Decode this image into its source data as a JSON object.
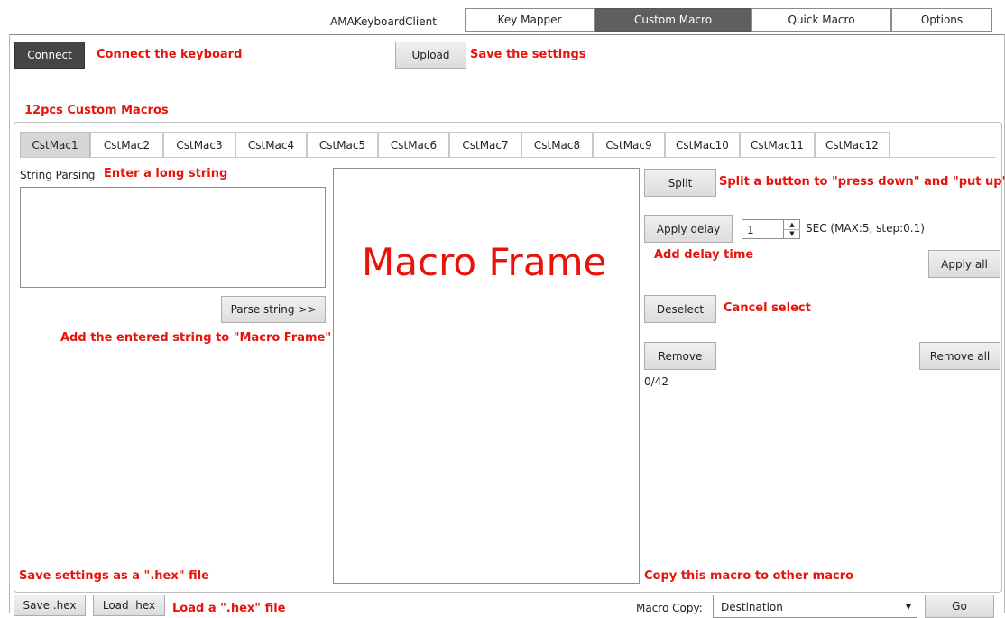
{
  "app": {
    "title": "AMAKeyboardClient",
    "tabs": [
      {
        "label": "Key Mapper"
      },
      {
        "label": "Custom Macro"
      },
      {
        "label": "Quick Macro"
      },
      {
        "label": "Options"
      }
    ],
    "active_tab": "Custom Macro"
  },
  "toolbar": {
    "connect_label": "Connect",
    "connect_note": "Connect the keyboard",
    "upload_label": "Upload",
    "upload_note": "Save the settings"
  },
  "macros": {
    "section_note": "12pcs Custom Macros",
    "tabs": [
      "CstMac1",
      "CstMac2",
      "CstMac3",
      "CstMac4",
      "CstMac5",
      "CstMac6",
      "CstMac7",
      "CstMac8",
      "CstMac9",
      "CstMac10",
      "CstMac11",
      "CstMac12"
    ],
    "active_tab": "CstMac1"
  },
  "parsing": {
    "label": "String Parsing",
    "label_note": "Enter a long string",
    "input_value": "",
    "parse_button": "Parse string >>",
    "parse_note": "Add the entered string to  \"Macro Frame\""
  },
  "frame": {
    "overlay": "Macro Frame"
  },
  "controls": {
    "split_label": "Split",
    "split_note": "Split a button to \"press down\" and \"put up\"",
    "apply_delay_label": "Apply delay",
    "delay_value": "1",
    "delay_unit": "SEC (MAX:5, step:0.1)",
    "delay_note": "Add delay time",
    "apply_all_label": "Apply all",
    "deselect_label": "Deselect",
    "deselect_note": "Cancel select",
    "remove_label": "Remove",
    "remove_all_label": "Remove all",
    "count": "0/42"
  },
  "bottom": {
    "save_note": "Save settings as a  \".hex\" file",
    "copy_note": "Copy this macro to other macro",
    "save_hex_label": "Save .hex",
    "load_hex_label": "Load .hex",
    "load_note": "Load a  \".hex\" file",
    "macro_copy_label": "Macro Copy:",
    "destination_value": "Destination",
    "go_label": "Go"
  },
  "colors": {
    "annotation": "#e8130b",
    "active_tab": "#5f5f5f",
    "connect_button": "#454545"
  }
}
